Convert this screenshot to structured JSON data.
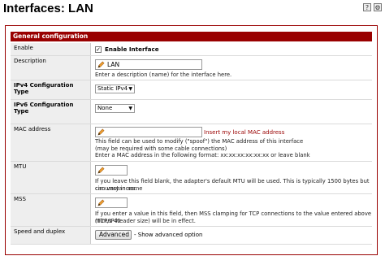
{
  "page": {
    "title": "Interfaces: LAN"
  },
  "top_icons": [
    "help-icon",
    "settings-icon"
  ],
  "panel": {
    "header": "General configuration"
  },
  "fields": {
    "enable": {
      "label": "Enable",
      "checkbox_label": "Enable Interface",
      "checked": true
    },
    "description": {
      "label": "Description",
      "value": "LAN",
      "help": "Enter a description (name) for the interface here."
    },
    "ipv4": {
      "label": "IPv4 Configuration Type",
      "selected": "Static IPv4"
    },
    "ipv6": {
      "label": "IPv6 Configuration Type",
      "selected": "None"
    },
    "mac": {
      "label": "MAC address",
      "value": "",
      "insert_link": "Insert my local MAC address",
      "help1": "This field can be used to modify (\"spoof\") the MAC address of this interface",
      "help2": "(may be required with some cable connections)",
      "help3": "Enter a MAC address in the following format: xx:xx:xx:xx:xx:xx or leave blank"
    },
    "mtu": {
      "label": "MTU",
      "value": "",
      "help1": "If you leave this field blank, the adapter's default MTU will be used. This is typically 1500 bytes but can vary in some",
      "help2": "circumstances."
    },
    "mss": {
      "label": "MSS",
      "value": "",
      "help1": "If you enter a value in this field, then MSS clamping for TCP connections to the value entered above minus 40",
      "help2": "(TCP/IP header size) will be in effect."
    },
    "speed": {
      "label": "Speed and duplex",
      "button": "Advanced",
      "suffix": "- Show advanced option"
    }
  }
}
